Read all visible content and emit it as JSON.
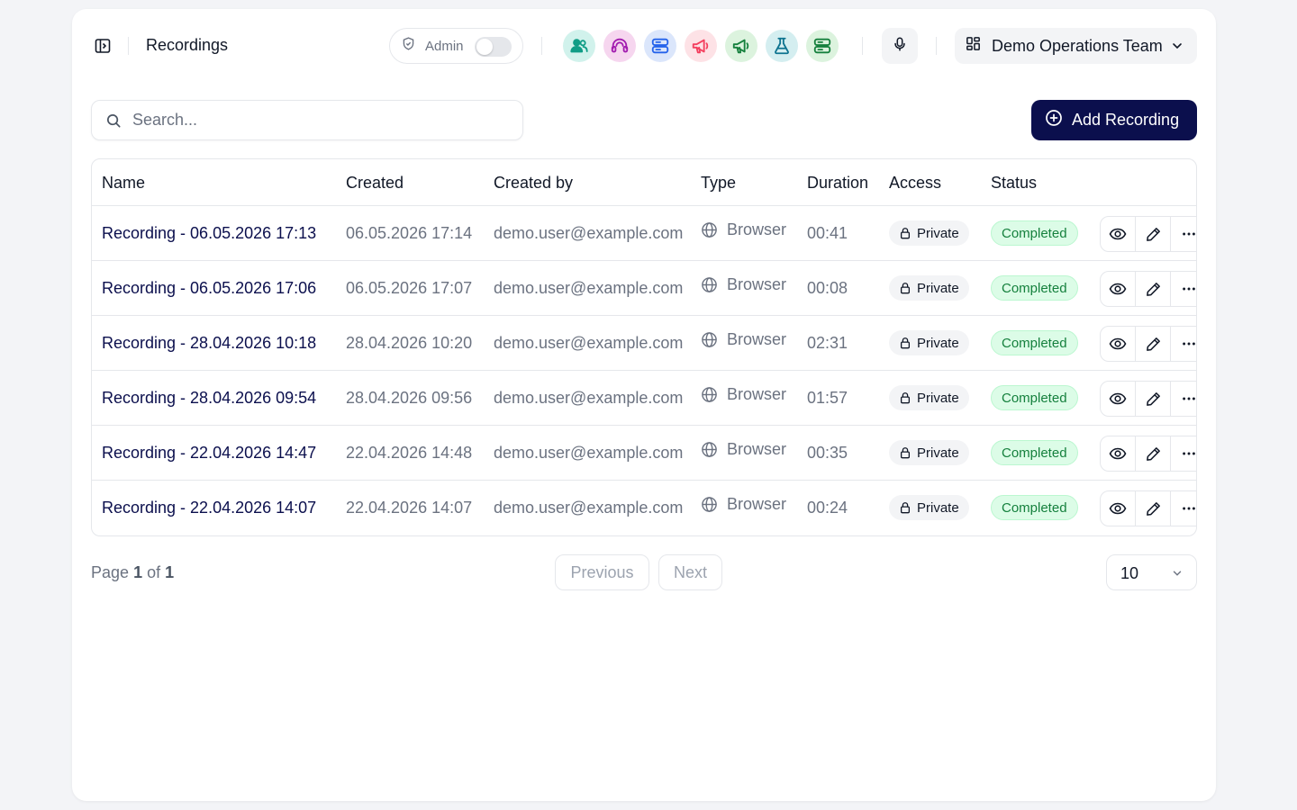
{
  "header": {
    "title": "Recordings",
    "admin_label": "Admin",
    "admin_enabled": false,
    "team_name": "Demo Operations Team"
  },
  "apps": [
    {
      "icon": "users-icon",
      "bg": "#d1f2ec",
      "color": "#0f9d86"
    },
    {
      "icon": "headset-icon",
      "bg": "#f6d6ef",
      "color": "#a21caf"
    },
    {
      "icon": "server-icon",
      "bg": "#dbe6fb",
      "color": "#2563eb"
    },
    {
      "icon": "megaphone-icon",
      "bg": "#fde2e6",
      "color": "#f43f5e"
    },
    {
      "icon": "megaphone-icon",
      "bg": "#dcf3de",
      "color": "#15803d"
    },
    {
      "icon": "flask-icon",
      "bg": "#d4eef0",
      "color": "#0e7490"
    },
    {
      "icon": "server-icon",
      "bg": "#dcf3de",
      "color": "#15803d"
    }
  ],
  "search": {
    "placeholder": "Search..."
  },
  "add_button": "Add Recording",
  "table": {
    "headers": {
      "name": "Name",
      "created": "Created",
      "created_by": "Created by",
      "type": "Type",
      "duration": "Duration",
      "access": "Access",
      "status": "Status"
    },
    "rows": [
      {
        "name": "Recording - 06.05.2026 17:13",
        "created": "06.05.2026 17:14",
        "created_by": "demo.user@example.com",
        "type": "Browser",
        "duration": "00:41",
        "access": "Private",
        "status": "Completed"
      },
      {
        "name": "Recording - 06.05.2026 17:06",
        "created": "06.05.2026 17:07",
        "created_by": "demo.user@example.com",
        "type": "Browser",
        "duration": "00:08",
        "access": "Private",
        "status": "Completed"
      },
      {
        "name": "Recording - 28.04.2026 10:18",
        "created": "28.04.2026 10:20",
        "created_by": "demo.user@example.com",
        "type": "Browser",
        "duration": "02:31",
        "access": "Private",
        "status": "Completed"
      },
      {
        "name": "Recording - 28.04.2026 09:54",
        "created": "28.04.2026 09:56",
        "created_by": "demo.user@example.com",
        "type": "Browser",
        "duration": "01:57",
        "access": "Private",
        "status": "Completed"
      },
      {
        "name": "Recording - 22.04.2026 14:47",
        "created": "22.04.2026 14:48",
        "created_by": "demo.user@example.com",
        "type": "Browser",
        "duration": "00:35",
        "access": "Private",
        "status": "Completed"
      },
      {
        "name": "Recording - 22.04.2026 14:07",
        "created": "22.04.2026 14:07",
        "created_by": "demo.user@example.com",
        "type": "Browser",
        "duration": "00:24",
        "access": "Private",
        "status": "Completed"
      }
    ]
  },
  "pagination": {
    "page_word": "Page",
    "current": "1",
    "of_word": "of",
    "total": "1",
    "previous": "Previous",
    "next": "Next",
    "page_size": "10"
  },
  "colors": {
    "accent": "#0b0f4d",
    "status_completed_bg": "#dcfce7",
    "status_completed_text": "#15803d"
  }
}
